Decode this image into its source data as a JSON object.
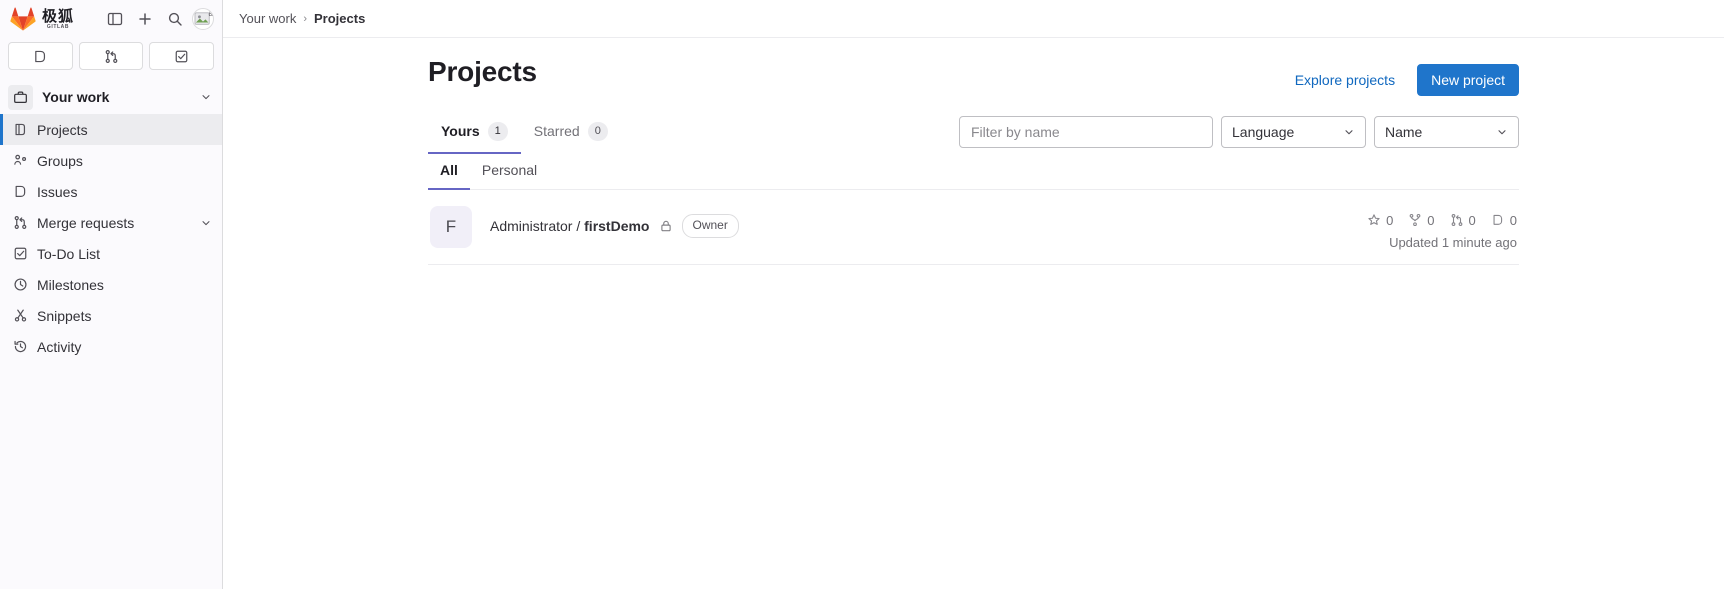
{
  "sidebar": {
    "brand": {
      "name": "极狐",
      "sub": "GITLAB",
      "logo_icon": "gitlab-tanuki-icon"
    },
    "top_actions": [
      {
        "name": "toggle-sidebar-button",
        "icon": "sidebar-panel-icon"
      },
      {
        "name": "create-new-button",
        "icon": "plus-icon"
      },
      {
        "name": "search-button",
        "icon": "search-icon"
      }
    ],
    "avatar": {
      "name": "user-avatar",
      "alt": "a"
    },
    "shortcuts": [
      {
        "name": "shortcut-issues",
        "icon": "issues-icon"
      },
      {
        "name": "shortcut-merge-requests",
        "icon": "merge-request-icon"
      },
      {
        "name": "shortcut-todos",
        "icon": "todo-check-icon"
      }
    ],
    "section": {
      "label": "Your work",
      "icon": "work-briefcase-icon",
      "expanded": true
    },
    "items": [
      {
        "label": "Projects",
        "icon": "project-icon",
        "active": true,
        "has_chevron": false
      },
      {
        "label": "Groups",
        "icon": "group-icon",
        "active": false,
        "has_chevron": false
      },
      {
        "label": "Issues",
        "icon": "issues-icon",
        "active": false,
        "has_chevron": false
      },
      {
        "label": "Merge requests",
        "icon": "merge-request-icon",
        "active": false,
        "has_chevron": true
      },
      {
        "label": "To-Do List",
        "icon": "todo-check-icon",
        "active": false,
        "has_chevron": false
      },
      {
        "label": "Milestones",
        "icon": "clock-icon",
        "active": false,
        "has_chevron": false
      },
      {
        "label": "Snippets",
        "icon": "scissors-icon",
        "active": false,
        "has_chevron": false
      },
      {
        "label": "Activity",
        "icon": "history-icon",
        "active": false,
        "has_chevron": false
      }
    ]
  },
  "breadcrumb": {
    "parent": "Your work",
    "separator": "›",
    "current": "Projects"
  },
  "header": {
    "title": "Projects",
    "explore_label": "Explore projects",
    "new_project_label": "New project",
    "accent_color": "#1f75cb"
  },
  "tabs": [
    {
      "label": "Yours",
      "count": "1",
      "active": true
    },
    {
      "label": "Starred",
      "count": "0",
      "active": false
    }
  ],
  "filters": {
    "search_placeholder": "Filter by name",
    "search_value": "",
    "language": {
      "label": "Language",
      "icon": "chevron-down-icon"
    },
    "sort": {
      "label": "Name",
      "icon": "chevron-down-icon"
    }
  },
  "subtabs": [
    {
      "label": "All",
      "active": true
    },
    {
      "label": "Personal",
      "active": false
    }
  ],
  "projects": [
    {
      "avatar_letter": "F",
      "namespace": "Administrator",
      "separator": "/",
      "name": "firstDemo",
      "visibility_icon": "lock-icon",
      "role_badge": "Owner",
      "stats": [
        {
          "name": "stars",
          "icon": "star-icon",
          "value": "0"
        },
        {
          "name": "forks",
          "icon": "fork-icon",
          "value": "0"
        },
        {
          "name": "merge-requests",
          "icon": "merge-request-icon",
          "value": "0"
        },
        {
          "name": "issues",
          "icon": "issues-icon",
          "value": "0"
        }
      ],
      "updated": "Updated 1 minute ago"
    }
  ]
}
